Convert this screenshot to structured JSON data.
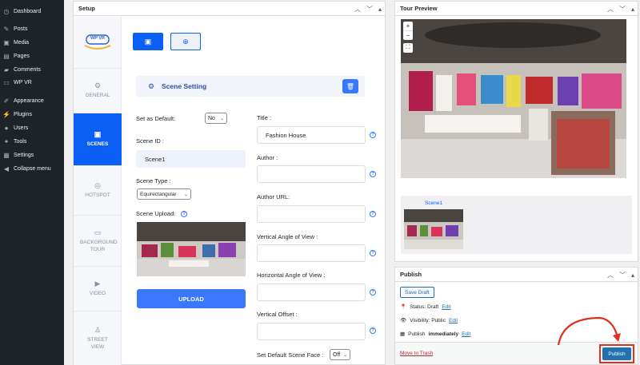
{
  "sidebar": {
    "items": [
      {
        "label": "Dashboard",
        "icon": "dashboard-icon",
        "glyph": "◷"
      },
      {
        "label": "Posts",
        "icon": "pin-icon",
        "glyph": "✎"
      },
      {
        "label": "Media",
        "icon": "media-icon",
        "glyph": "▣"
      },
      {
        "label": "Pages",
        "icon": "pages-icon",
        "glyph": "▤"
      },
      {
        "label": "Comments",
        "icon": "comment-icon",
        "glyph": "▰"
      },
      {
        "label": "WP VR",
        "icon": "wpvr-icon",
        "glyph": "▭"
      },
      {
        "label": "Appearance",
        "icon": "brush-icon",
        "glyph": "✐"
      },
      {
        "label": "Plugins",
        "icon": "plugin-icon",
        "glyph": "⚡"
      },
      {
        "label": "Users",
        "icon": "user-icon",
        "glyph": "●"
      },
      {
        "label": "Tools",
        "icon": "wrench-icon",
        "glyph": "✦"
      },
      {
        "label": "Settings",
        "icon": "settings-icon",
        "glyph": "▦"
      },
      {
        "label": "Collapse menu",
        "icon": "collapse-icon",
        "glyph": "◀"
      }
    ]
  },
  "setup": {
    "title": "Setup",
    "logo_text": "WP VR",
    "nav": [
      {
        "label": "GENERAL",
        "icon": "gear-icon",
        "glyph": "⚙"
      },
      {
        "label": "SCENES",
        "icon": "image-icon",
        "glyph": "▣"
      },
      {
        "label": "HOTSPOT",
        "icon": "target-icon",
        "glyph": "◎"
      },
      {
        "label": "BACKGROUND TOUR",
        "icon": "background-icon",
        "glyph": "▭"
      },
      {
        "label": "VIDEO",
        "icon": "video-icon",
        "glyph": "▶"
      },
      {
        "label": "STREET VIEW",
        "icon": "street-view-icon",
        "glyph": "♙"
      }
    ],
    "scene_setting_label": "Scene Setting",
    "set_default_label": "Set as Default:",
    "set_default_value": "No",
    "scene_id_label": "Scene ID :",
    "scene_id_value": "Scene1",
    "scene_type_label": "Scene Type :",
    "scene_type_value": "Equirectangular",
    "scene_upload_label": "Scene Upload:",
    "upload_button": "UPLOAD",
    "title_label": "Title :",
    "title_value": "Fashion House",
    "author_label": "Author :",
    "author_url_label": "Author URL:",
    "v_angle_label": "Vertical Angle of View :",
    "h_angle_label": "Horizontal Angle of View :",
    "v_offset_label": "Vertical Offset :",
    "default_face_label": "Set Default Scene Face :",
    "default_face_value": "Off"
  },
  "preview": {
    "title": "Tour Preview",
    "thumb_label": "Scene1"
  },
  "publish": {
    "title": "Publish",
    "save_draft": "Save Draft",
    "status_label": "Status: Draft",
    "status_edit": "Edit",
    "visibility_label": "Visibility: Public",
    "visibility_edit": "Edit",
    "publish_when_prefix": "Publish",
    "publish_when_value": "immediately",
    "publish_when_edit": "Edit",
    "trash_link": "Move to Trash",
    "publish_button": "Publish"
  },
  "colors": {
    "admin_bar": "#1d2327",
    "accent": "#0c5ff4",
    "wp_blue": "#2271b1",
    "highlight": "#e0301e"
  }
}
